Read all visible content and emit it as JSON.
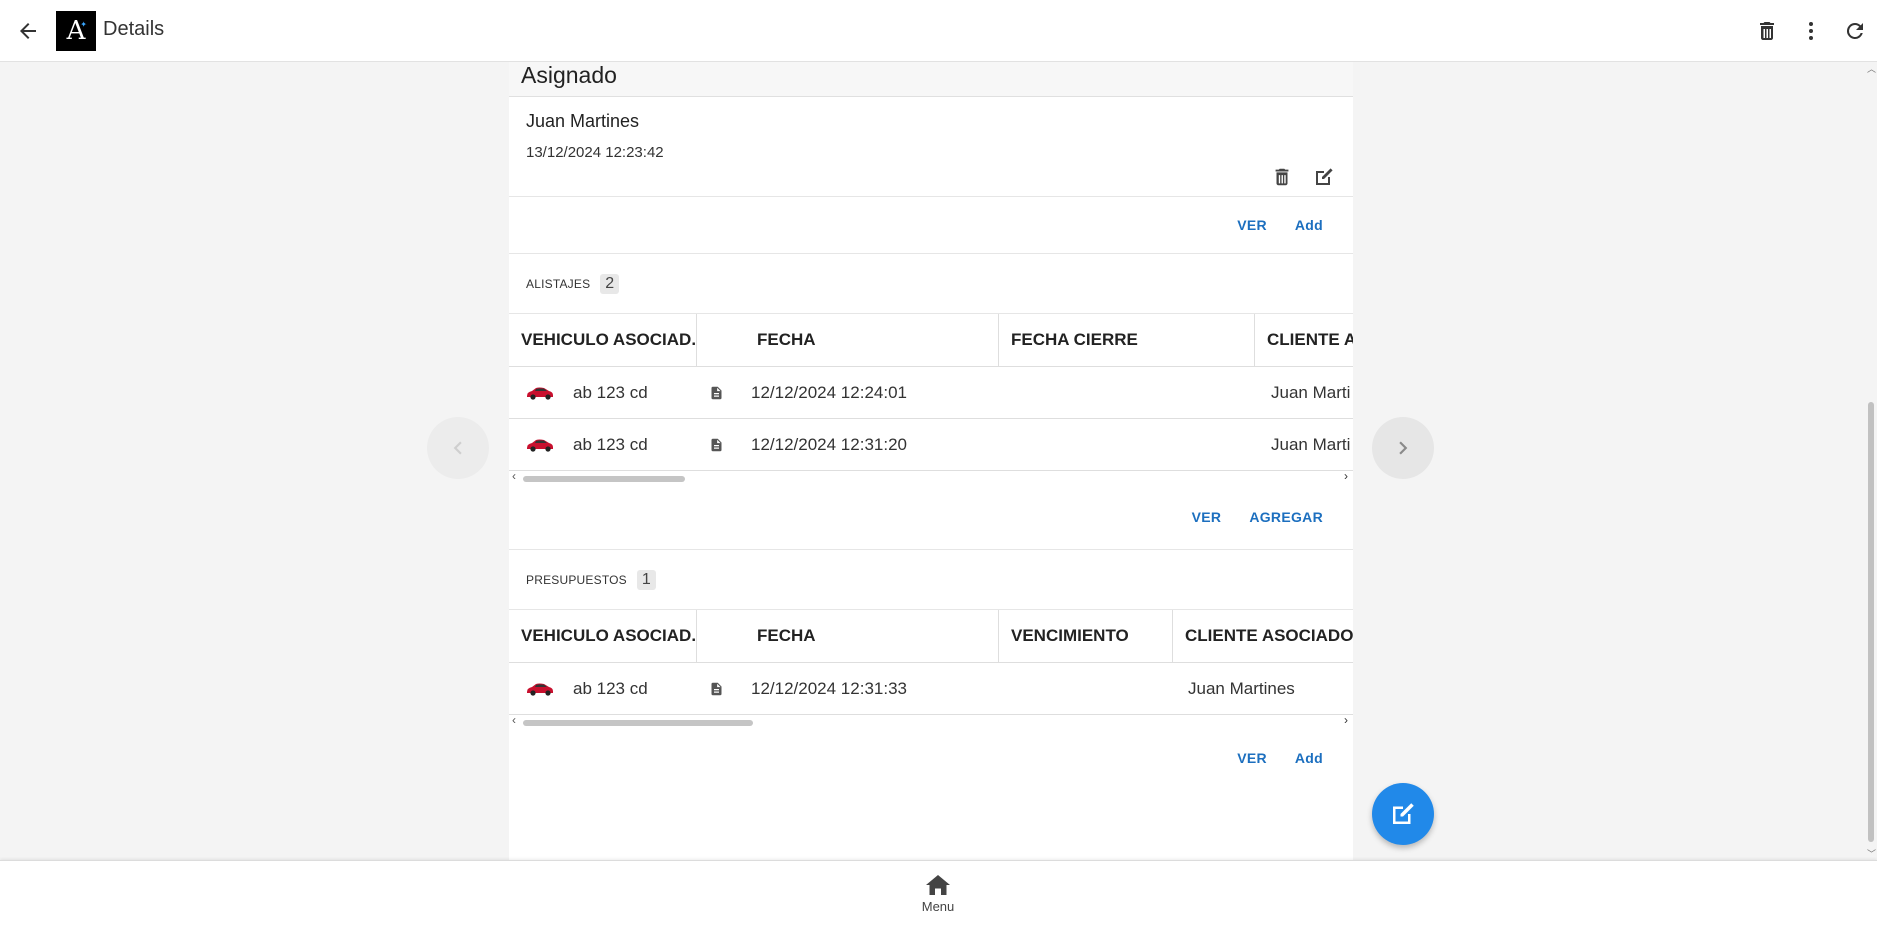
{
  "header": {
    "title": "Details",
    "logo_text": "A"
  },
  "asignado": {
    "title": "Asignado",
    "name": "Juan Martines",
    "date": "13/12/2024 12:23:42",
    "links": {
      "ver": "VER",
      "add": "Add"
    }
  },
  "alistajes": {
    "label": "ALISTAJES",
    "count": "2",
    "columns": [
      "VEHICULO ASOCIAD...",
      "FECHA",
      "FECHA CIERRE",
      "CLIENTE A"
    ],
    "rows": [
      {
        "vehicle": "ab 123 cd",
        "fecha": "12/12/2024 12:24:01",
        "fecha_cierre": "",
        "cliente": "Juan Marti"
      },
      {
        "vehicle": "ab 123 cd",
        "fecha": "12/12/2024 12:31:20",
        "fecha_cierre": "",
        "cliente": "Juan Marti"
      }
    ],
    "links": {
      "ver": "VER",
      "agregar": "AGREGAR"
    }
  },
  "presupuestos": {
    "label": "PRESUPUESTOS",
    "count": "1",
    "columns": [
      "VEHICULO ASOCIAD...",
      "FECHA",
      "VENCIMIENTO",
      "CLIENTE ASOCIADO"
    ],
    "rows": [
      {
        "vehicle": "ab 123 cd",
        "fecha": "12/12/2024 12:31:33",
        "vencimiento": "",
        "cliente": "Juan Martines"
      }
    ],
    "links": {
      "ver": "VER",
      "add": "Add"
    }
  },
  "bottom_nav": {
    "menu_label": "Menu"
  },
  "colors": {
    "accent": "#2189e9",
    "link": "#1c6fbf"
  },
  "icons": [
    "back-arrow-icon",
    "trash-icon",
    "more-vert-icon",
    "refresh-icon",
    "edit-icon",
    "car-icon",
    "document-icon",
    "chevron-left-icon",
    "chevron-right-icon",
    "home-icon"
  ]
}
